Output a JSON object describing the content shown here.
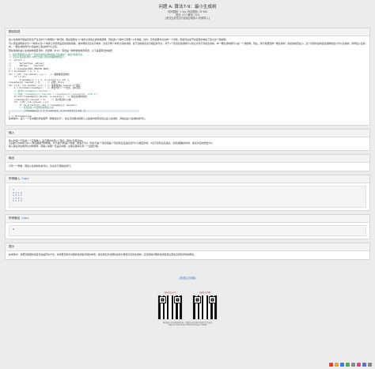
{
  "header": {
    "title": "问题 A: 算法7-9：最小生成树",
    "limits": "时间限制: 1 Sec  内存限制: 32 MB",
    "stats": "提交: 477  解决: 224",
    "links": "[提交][状态][讨论版][命题人:外部导入]"
  },
  "description": {
    "heading": "题目描述",
    "text": [
      "最小生成树问题是实际生产生活中十分重要的一类问题。假设需要在n个城市之间建立通信联络网，则连通n个城市只需要n-1条线路。这时，自然需要考虑这样一个问题，即如何在最节省经费的前提下建立这个通信网。",
      "可以用连通网来表示n个城市以及n个城市之间可能设置的通信线路，其中网的顶点表示城市，边表示两个城市之间的线路，赋于边的权值表示相应的代价。对于n个顶点的连通网可以建立许多不同的生成树，每一棵生成树都可以是一个通信网。现在，我们需要选择一棵生成树，使总的耗费最小。这个问题就是构造连通网的最小代价生成树，简称最小生成树。一棵生成树的代价就是树上各边的代价之和。",
      "而在常用的最小生成树构造算法中，普里姆（Prim）算法是一种非常常用的算法。以下是其算法的描述："
    ],
    "code": [
      [
        "c",
        "// 用普里姆算法从第u个顶点出发构造网G的最小生成树T，输出T的各条边。"
      ],
      [
        "c",
        "// 记录从顶点集U到V-U的代价最小的边的辅助数组定义："
      ],
      [
        "n",
        "//  struct {"
      ],
      [
        "n",
        "//      VertexType  adjvex;"
      ],
      [
        "n",
        "//      VRType     lowcost;"
      ],
      [
        "n",
        "//  } closedge[MAX_VERTEX_NUM];"
      ],
      [
        "n",
        "k = LocateVex ( G, u );"
      ],
      [
        "n",
        "for ( j=0; j<G.vexnum; ++j )   // 辅助数组初始化"
      ],
      [
        "n",
        "    if (j!=k)"
      ],
      [
        "n",
        "        closedge[j] = { u, G.arcs[k][j].adj };"
      ],
      [
        "n",
        "closedge[k].lowcost = 0;     // 初始，U={u}"
      ],
      [
        "n",
        "for (i=1; i<G.vexnum; ++i) { // 选择其余G.vexnum-1个顶点"
      ],
      [
        "n",
        "    k = minimum(closedge);   // 求出T的下一个结点：第k顶点"
      ],
      [
        "c",
        "    // 此时closedge[k].lowcost ="
      ],
      [
        "c",
        "    // MIN{ closedge[vi].lowcost | closedge[vi].lowcost>0, vi∈V-U }"
      ],
      [
        "n",
        "    printf(closedge[k].adjvex, G.vexs[k]);  // 输出生成树的边"
      ],
      [
        "n",
        "    closedge[k].lowcost = 0;    // 第k顶点并入U集"
      ],
      [
        "n",
        "    for (j=0; j<G.vexnum; ++j)"
      ],
      [
        "n",
        "        if (G.arcs[k][j].adj < closedge[j].lowcost)"
      ],
      [
        "c",
        "        // 新顶点并入U后重新选择最小边"
      ],
      [
        "h",
        "            closedge[j] = { G.vexs[k], G.arcs[k][j].adj };"
      ],
      [
        "n",
        "}"
      ],
      [
        "n",
        "} // MiniSpanTree"
      ]
    ],
    "closing": "在本题中，读入一个无向图的邻接矩阵（即数组表示），建立无向图并按照以上描述中的算法建立最小生成树，并输出最小生成树的代价。"
  },
  "input": {
    "heading": "输入",
    "text": [
      "输入的第一行包含一个正整数n，表示图中共有n个顶点。其中n不超过50。",
      "以后的n行中每行有n个用空格隔开的整数，对于第i行的第j个整数，如果不为0，则表示第i个顶点和第j个顶点有直接连接且代价为相应的值，0表示没有直接连接。当i和j相等的时候，保证对应的整数为0。",
      "输入保证邻接矩阵为对称矩阵，即输入的图一定是无向图，且保证图中只有一个连通分量。"
    ]
  },
  "output": {
    "heading": "输出",
    "text": "只有一个整数，即最小生成树的总代价。请注意行尾输出换行。"
  },
  "sample_input": {
    "heading": "样例输入",
    "copy_label": "Copy",
    "lines": [
      "4",
      "0 2 4 0",
      "2 0 3 5",
      "4 3 0 1",
      "0 5 1 0"
    ]
  },
  "sample_output": {
    "heading": "样例输出",
    "copy_label": "Copy",
    "lines": [
      "6"
    ]
  },
  "hint": {
    "heading": "提示",
    "text": "在本题中，需要掌握图的深度优先遍历的方法，并需要掌握无向图的连通性问题的本质。通过求出无向图的连通分量和对应的生成树，应该能够对图的连通性建立更加直观和清晰的概念。"
  },
  "footer": {
    "link": "[状态][讨论版]",
    "qr_left_caption": "扫码关注公众号",
    "qr_right_caption": "扫码加入QQ群",
    "credit_line1": "本站由公式在线技术支持，感谢公式在线对本站的大力支持",
    "credit_line2": "GPL2.0 2003-2022 HUSTOJ Project TEAM"
  },
  "tray_colors": [
    "#e0452e",
    "#f2a12b",
    "#3d7fd6",
    "#4caf50",
    "#8a8a8a",
    "#d64c8a",
    "#5b6fd6",
    "#888888"
  ]
}
